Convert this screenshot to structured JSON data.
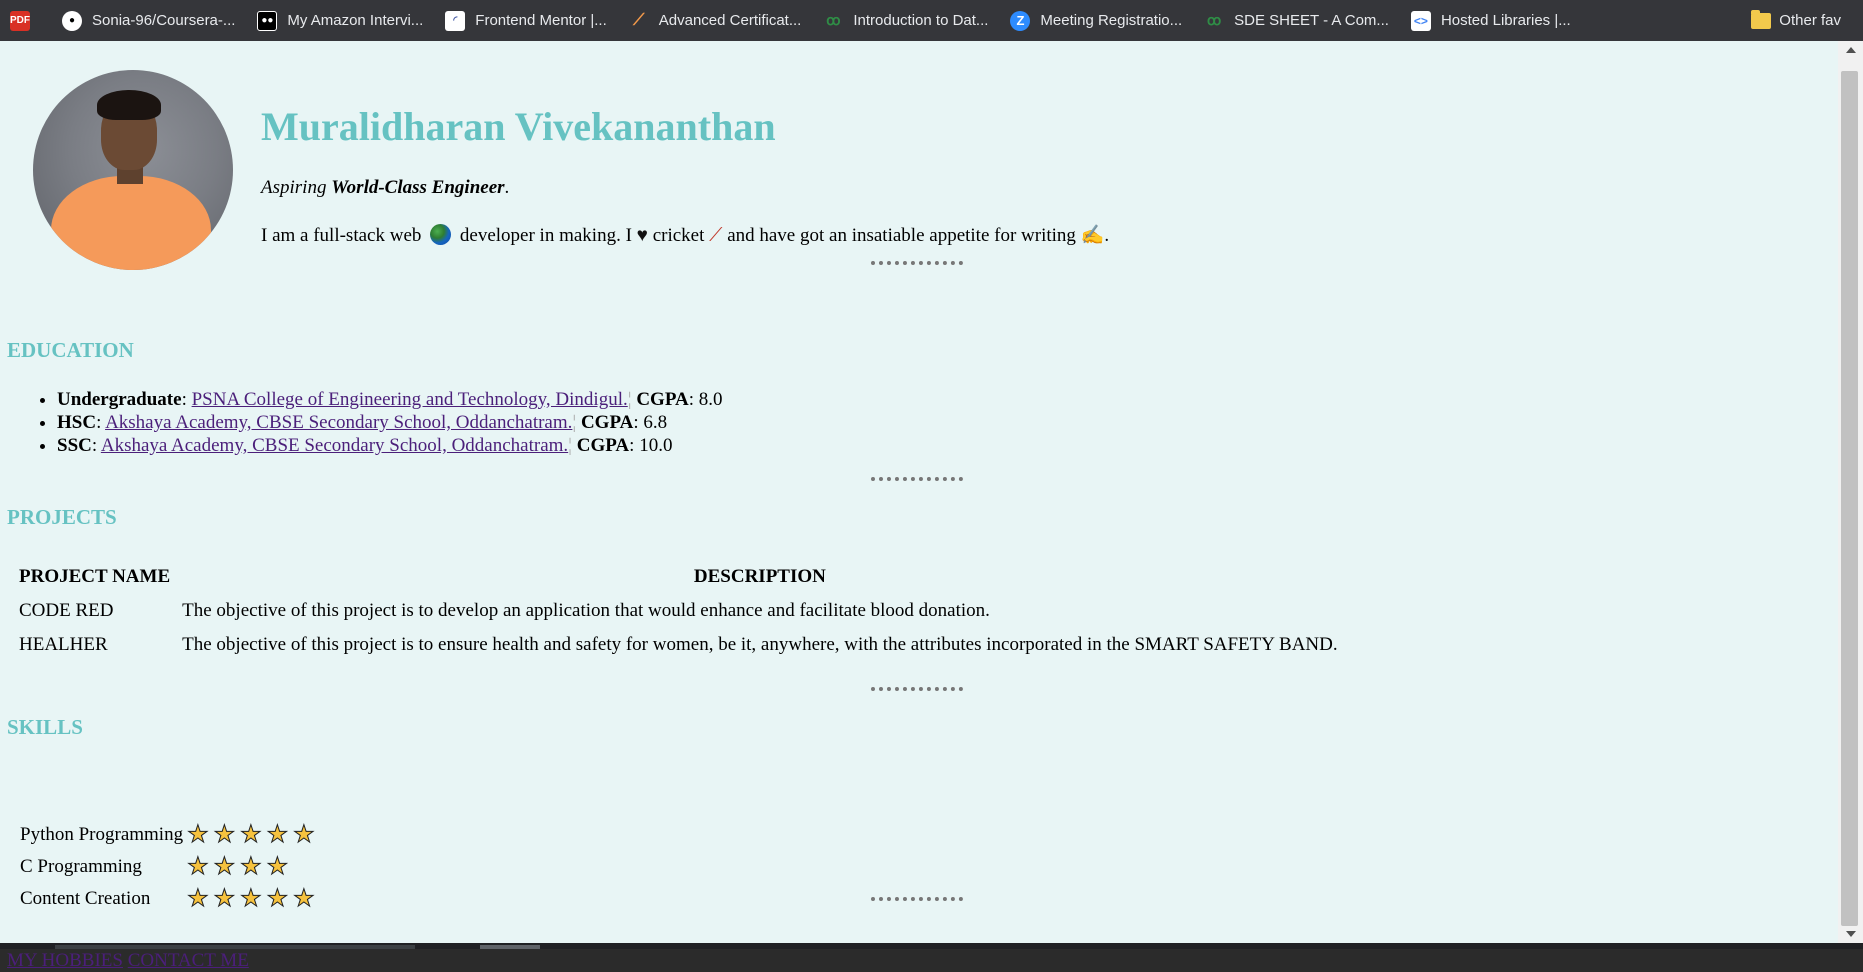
{
  "bookmarks": [
    {
      "label": "",
      "icon": "pdf-icon"
    },
    {
      "label": "Sonia-96/Coursera-...",
      "icon": "github-icon"
    },
    {
      "label": "My Amazon Intervi...",
      "icon": "medium-icon"
    },
    {
      "label": "Frontend Mentor |...",
      "icon": "frontend-mentor-icon"
    },
    {
      "label": "Advanced Certificat...",
      "icon": "certificate-icon"
    },
    {
      "label": "Introduction to Dat...",
      "icon": "gfg-icon"
    },
    {
      "label": "Meeting Registratio...",
      "icon": "zoom-icon"
    },
    {
      "label": "SDE SHEET - A Com...",
      "icon": "gfg-icon"
    },
    {
      "label": "Hosted Libraries |...",
      "icon": "google-developers-icon"
    }
  ],
  "bookmarks_other": "Other fav",
  "profile": {
    "name": "Muralidharan Vivekananthan",
    "tagline_prefix": "Aspiring ",
    "tagline_bold": "World-Class Engineer",
    "tagline_suffix": ".",
    "bio_1": "I am a full-stack web",
    "bio_2": "developer in making. I",
    "bio_3": "cricket",
    "bio_4": "and have got an insatiable appetite for writing",
    "bio_5": "."
  },
  "education": {
    "heading": "EDUCATION",
    "items": [
      {
        "level": "Undergraduate",
        "school": "PSNA College of Engineering and Technology, Dindigul.",
        "grade_label": "CGPA",
        "grade": "8.0"
      },
      {
        "level": "HSC",
        "school": "Akshaya Academy, CBSE Secondary School, Oddanchatram.",
        "grade_label": "CGPA",
        "grade": "6.8"
      },
      {
        "level": "SSC",
        "school": "Akshaya Academy, CBSE Secondary School, Oddanchatram.",
        "grade_label": "CGPA",
        "grade": "10.0"
      }
    ]
  },
  "projects": {
    "heading": "PROJECTS",
    "col_name": "PROJECT NAME",
    "col_desc": "DESCRIPTION",
    "rows": [
      {
        "name": "CODE RED",
        "desc": "The objective of this project is to develop an application that would enhance and facilitate blood donation."
      },
      {
        "name": "HEALHER",
        "desc": "The objective of this project is to ensure health and safety for women, be it, anywhere, with the attributes incorporated in the SMART SAFETY BAND."
      }
    ]
  },
  "skills": {
    "heading": "SKILLS",
    "items": [
      {
        "name": "Python Programming",
        "stars": 5
      },
      {
        "name": "C Programming",
        "stars": 4
      },
      {
        "name": "Content Creation",
        "stars": 5
      }
    ]
  },
  "footer": {
    "hobbies": "MY HOBBIES",
    "contact": "CONTACT ME"
  },
  "colors": {
    "accent": "#66c2c2",
    "page_bg": "#e8f5f5",
    "link": "#4b1f7a"
  }
}
